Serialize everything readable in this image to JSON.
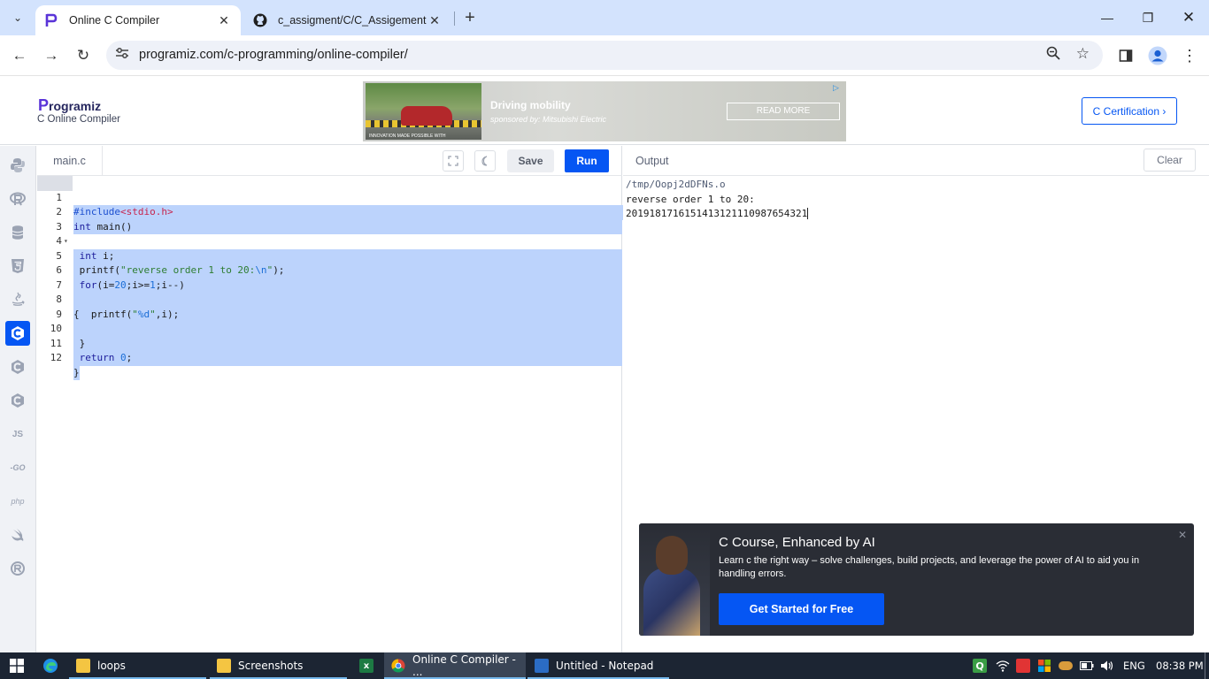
{
  "browser": {
    "tabs": [
      {
        "title": "Online C Compiler",
        "active": true,
        "icon": "programiz-icon"
      },
      {
        "title": "c_assigment/C/C_Assigement at",
        "active": false,
        "icon": "github-icon"
      }
    ],
    "url": "programiz.com/c-programming/online-compiler/"
  },
  "site": {
    "logo_letter": "P",
    "logo_text": "rogramiz",
    "logo_subtitle": "C Online Compiler",
    "ad": {
      "title": "Driving mobility",
      "sponsor": "sponsored by: Mitsubishi Electric",
      "cta": "READ MORE",
      "fine_print": "INNOVATION MADE POSSIBLE WITH"
    },
    "certification_button": "C Certification ›"
  },
  "languages": [
    "python",
    "r",
    "sql",
    "html",
    "java",
    "c",
    "cpp",
    "csharp",
    "javascript",
    "go",
    "php",
    "swift",
    "rust"
  ],
  "editor": {
    "filename": "main.c",
    "save_label": "Save",
    "run_label": "Run",
    "lines": [
      {
        "n": "1",
        "text": "#include<stdio.h>"
      },
      {
        "n": "2",
        "text": "int main()"
      },
      {
        "n": "3",
        "text": "{"
      },
      {
        "n": "4",
        "text": " int i;"
      },
      {
        "n": "5",
        "text": " printf(\"reverse order 1 to 20:\\n\");"
      },
      {
        "n": "6",
        "text": " for(i=20;i>=1;i--)"
      },
      {
        "n": "7",
        "text": ""
      },
      {
        "n": "8",
        "text": "{  printf(\"%d\",i);"
      },
      {
        "n": "9",
        "text": ""
      },
      {
        "n": "10",
        "text": " }"
      },
      {
        "n": "11",
        "text": " return 0;"
      },
      {
        "n": "12",
        "text": "}"
      }
    ]
  },
  "output": {
    "title": "Output",
    "clear_label": "Clear",
    "path": "/tmp/Oopj2dDFNs.o",
    "line1": "reverse order 1 to 20:",
    "line2": "2019181716151413121110987654321"
  },
  "promo": {
    "title": "C Course, Enhanced by AI",
    "description": "Learn c the right way – solve challenges, build projects, and leverage the power of AI to aid you in handling errors.",
    "button": "Get Started for Free"
  },
  "taskbar": {
    "items": [
      {
        "label": "loops"
      },
      {
        "label": "Screenshots"
      },
      {
        "label": "Online C Compiler - ..."
      },
      {
        "label": "Untitled - Notepad"
      }
    ],
    "language": "ENG",
    "time": "08:38 PM"
  },
  "colors": {
    "accent": "#0556f3",
    "selection": "#bcd3fc",
    "taskbar": "#1c2533"
  }
}
